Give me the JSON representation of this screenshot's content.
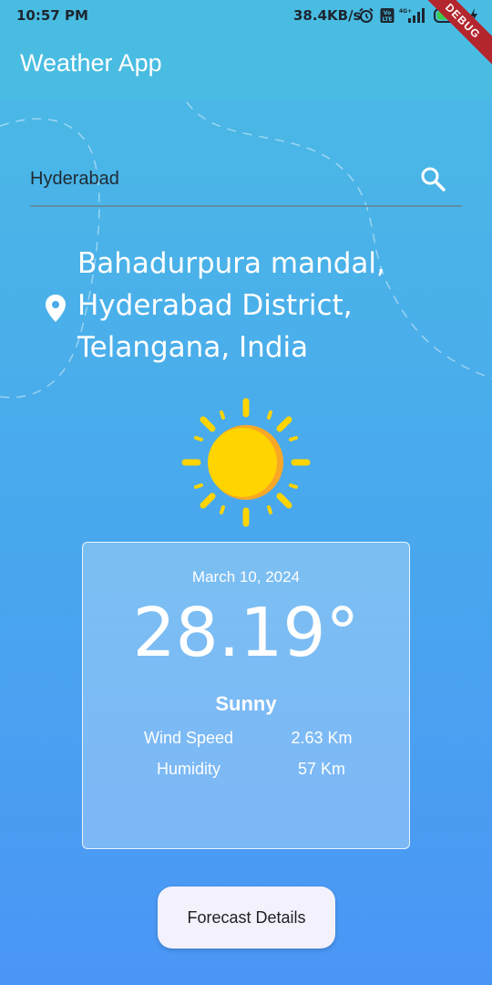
{
  "status_bar": {
    "time": "10:57 PM",
    "network_speed": "38.4KB/s",
    "icons": [
      "alarm-icon",
      "volte-icon",
      "signal-icon",
      "battery-icon",
      "charging-icon"
    ],
    "battery_level": "55"
  },
  "app_bar": {
    "title": "Weather App",
    "debug_label": "DEBUG"
  },
  "search": {
    "value": "Hyderabad",
    "icon": "search-icon"
  },
  "location": {
    "icon": "location-pin-icon",
    "lines": [
      "Bahadurpura mandal,",
      "Hyderabad District,",
      "Telangana, India"
    ]
  },
  "weather": {
    "icon": "sun-icon",
    "date": "March 10, 2024",
    "temperature": "28.19°",
    "condition": "Sunny",
    "wind_label": "Wind Speed",
    "wind_value": "2.63 Km",
    "humidity_label": "Humidity",
    "humidity_value": "57 Km"
  },
  "actions": {
    "forecast_button": "Forecast Details"
  },
  "colors": {
    "app_bar": "#49bce2",
    "gradient_top": "#4bbbe4",
    "gradient_bottom": "#4a96f6",
    "sun": "#ffd400",
    "sun_shade": "#f9a825",
    "button_bg": "#f3f1fc"
  }
}
